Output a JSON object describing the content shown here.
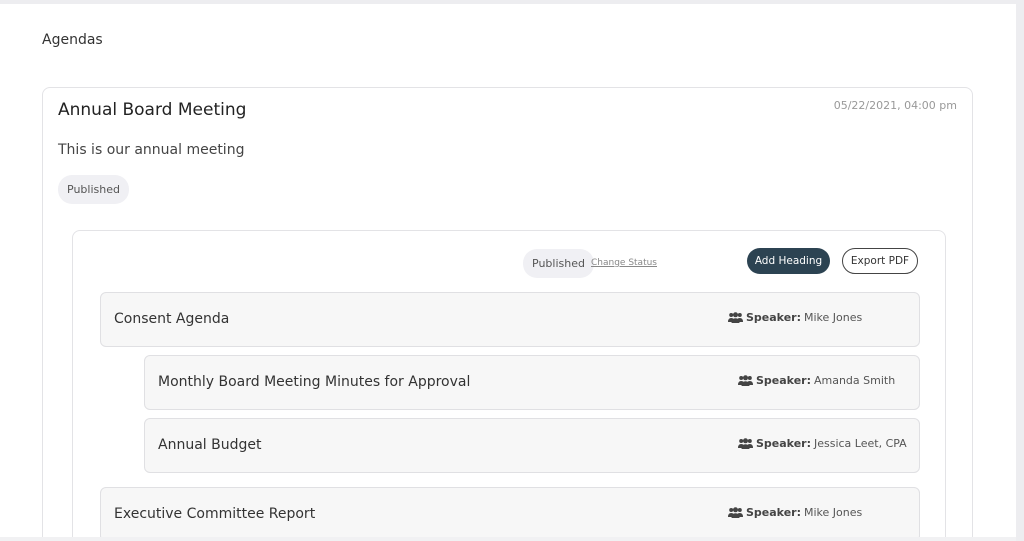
{
  "page": {
    "title": "Agendas"
  },
  "meeting": {
    "title": "Annual Board Meeting",
    "datetime": "05/22/2021, 04:00 pm",
    "description": "This is our annual meeting",
    "status": "Published"
  },
  "agenda_panel": {
    "status": "Published",
    "change_status_label": "Change Status",
    "add_heading_label": "Add Heading",
    "export_pdf_label": "Export PDF",
    "speaker_label": "Speaker:",
    "items": [
      {
        "title": "Consent Agenda",
        "speaker": "Mike Jones",
        "level": 0
      },
      {
        "title": "Monthly Board Meeting Minutes for Approval",
        "speaker": "Amanda Smith",
        "level": 1
      },
      {
        "title": "Annual Budget",
        "speaker": "Jessica Leet, CPA",
        "level": 1
      },
      {
        "title": "Executive Committee Report",
        "speaker": "Mike Jones",
        "level": 0
      }
    ]
  },
  "icons": {
    "speaker": "users-icon"
  },
  "colors": {
    "primary_button": "#2c4352",
    "pill_bg": "#f0f0f4",
    "item_bg": "#f7f7f7"
  }
}
